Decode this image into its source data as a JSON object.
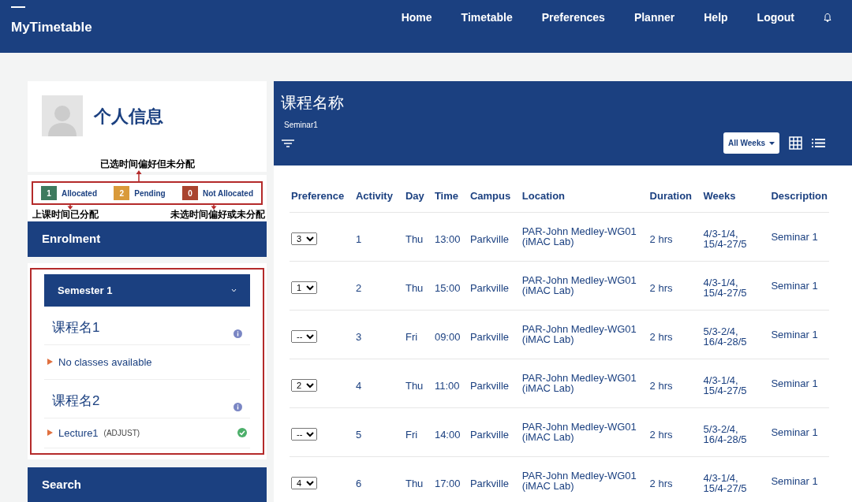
{
  "navbar": {
    "brand": "MyTimetable",
    "links": [
      {
        "label": "Home"
      },
      {
        "label": "Timetable"
      },
      {
        "label": "Preferences"
      },
      {
        "label": "Planner"
      },
      {
        "label": "Help"
      },
      {
        "label": "Logout"
      }
    ]
  },
  "profile": {
    "title": "个人信息"
  },
  "legend": {
    "annotation_top": "已选时间偏好但未分配",
    "annotation_left": "上课时间已分配",
    "annotation_right": "未选时间偏好或未分配",
    "items": [
      {
        "count": "1",
        "label": "Allocated",
        "color": "#3e7a5e"
      },
      {
        "count": "2",
        "label": "Pending",
        "color": "#d99a3a"
      },
      {
        "count": "0",
        "label": "Not Allocated",
        "color": "#a9442f"
      }
    ]
  },
  "enrolment": {
    "title": "Enrolment",
    "semester": {
      "label": "Semester 1",
      "expanded": true
    },
    "courses": [
      {
        "name": "课程名1",
        "classes": [
          {
            "kind": "empty",
            "label": "No classes available"
          }
        ]
      },
      {
        "name": "课程名2",
        "classes": [
          {
            "kind": "class",
            "label": "Lecture1",
            "tag": "(ADJUST)",
            "allocated": true
          }
        ]
      }
    ]
  },
  "search": {
    "title": "Search"
  },
  "panel": {
    "title": "课程名称",
    "subtitle": "Seminar1",
    "week_filter": "All Weeks"
  },
  "table": {
    "columns": [
      "Preference",
      "Activity",
      "Day",
      "Time",
      "Campus",
      "Location",
      "Duration",
      "Weeks",
      "Description"
    ],
    "rows": [
      {
        "preference": "3",
        "activity": "1",
        "day": "Thu",
        "time": "13:00",
        "campus": "Parkville",
        "location": [
          "PAR-John Medley-WG01",
          "(iMAC Lab)"
        ],
        "duration": "2 hrs",
        "weeks": [
          "4/3-1/4,",
          "15/4-27/5"
        ],
        "description": "Seminar 1"
      },
      {
        "preference": "1",
        "activity": "2",
        "day": "Thu",
        "time": "15:00",
        "campus": "Parkville",
        "location": [
          "PAR-John Medley-WG01",
          "(iMAC Lab)"
        ],
        "duration": "2 hrs",
        "weeks": [
          "4/3-1/4,",
          "15/4-27/5"
        ],
        "description": "Seminar 1"
      },
      {
        "preference": "--",
        "activity": "3",
        "day": "Fri",
        "time": "09:00",
        "campus": "Parkville",
        "location": [
          "PAR-John Medley-WG01",
          "(iMAC Lab)"
        ],
        "duration": "2 hrs",
        "weeks": [
          "5/3-2/4,",
          "16/4-28/5"
        ],
        "description": "Seminar 1"
      },
      {
        "preference": "2",
        "activity": "4",
        "day": "Thu",
        "time": "11:00",
        "campus": "Parkville",
        "location": [
          "PAR-John Medley-WG01",
          "(iMAC Lab)"
        ],
        "duration": "2 hrs",
        "weeks": [
          "4/3-1/4,",
          "15/4-27/5"
        ],
        "description": "Seminar 1"
      },
      {
        "preference": "--",
        "activity": "5",
        "day": "Fri",
        "time": "14:00",
        "campus": "Parkville",
        "location": [
          "PAR-John Medley-WG01",
          "(iMAC Lab)"
        ],
        "duration": "2 hrs",
        "weeks": [
          "5/3-2/4,",
          "16/4-28/5"
        ],
        "description": "Seminar 1"
      },
      {
        "preference": "4",
        "activity": "6",
        "day": "Thu",
        "time": "17:00",
        "campus": "Parkville",
        "location": [
          "PAR-John Medley-WG01",
          "(iMAC Lab)"
        ],
        "duration": "2 hrs",
        "weeks": [
          "4/3-1/4,",
          "15/4-27/5"
        ],
        "description": "Seminar 1"
      }
    ]
  }
}
